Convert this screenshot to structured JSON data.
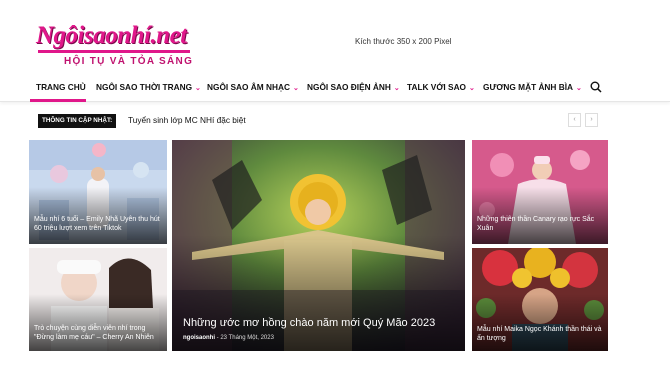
{
  "site": {
    "logo_text": "Ngôisaonhí.net",
    "tagline": "HỘI TỤ VÀ TỎA SÁNG",
    "ad_placeholder": "Kích thước 350 x 200 Pixel"
  },
  "nav": {
    "items": [
      {
        "label": "TRANG CHỦ"
      },
      {
        "label": "NGÔI SAO THỜI TRANG"
      },
      {
        "label": "NGÔI SAO ÂM NHẠC"
      },
      {
        "label": "NGÔI SAO ĐIỆN ẢNH"
      },
      {
        "label": "TALK VỚI SAO"
      },
      {
        "label": "GƯƠNG MẶT ẢNH BÌA"
      }
    ],
    "active": "TRANG CHỦ"
  },
  "ticker": {
    "label": "THÔNG TIN CẬP NHẬT:",
    "headline": "Tuyển sinh lớp MC NHí đặc biệt"
  },
  "posts": [
    {
      "title": "Mẫu nhí 6 tuổi – Emily Nhã Uyên thu hút 60 triệu lượt xem trên Tiktok"
    },
    {
      "title": "Trò chuyện cùng diễn viên nhí trong \"Đừng làm mẹ cáu\" – Cherry An Nhiên"
    },
    {
      "title": "Những ước mơ hồng chào năm mới Quý Mão 2023",
      "author": "ngoisaonhi",
      "date": "23 Tháng Một, 2023"
    },
    {
      "title": "Những thiên thần Canary rạo rực Sắc Xuân"
    },
    {
      "title": "Mẫu nhí Maika Ngọc Khánh thần thái và ấn tượng"
    }
  ],
  "colors": {
    "accent": "#e0178a"
  }
}
